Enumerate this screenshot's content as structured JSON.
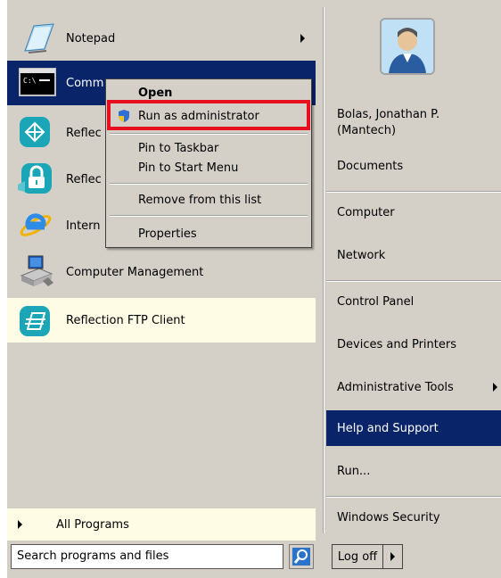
{
  "left": {
    "programs": [
      {
        "label": "Notepad",
        "icon": "notepad-icon",
        "has_submenu": true
      },
      {
        "label": "Comm",
        "icon": "command-prompt-icon",
        "has_submenu": false,
        "selected": true
      },
      {
        "label": "Reflec",
        "icon": "reflection-icon",
        "has_submenu": true
      },
      {
        "label": "Reflec",
        "icon": "reflection-lock-icon",
        "has_submenu": false
      },
      {
        "label": "Intern",
        "icon": "internet-explorer-icon",
        "has_submenu": false
      },
      {
        "label": "Computer Management",
        "icon": "computer-management-icon",
        "has_submenu": false
      },
      {
        "label": "Reflection FTP Client",
        "icon": "reflection-ftp-icon",
        "has_submenu": false,
        "new": true
      }
    ],
    "all_programs": "All Programs",
    "search_placeholder": "Search programs and files"
  },
  "right": {
    "user_name_line1": "Bolas, Jonathan P.",
    "user_name_line2": "(Mantech)",
    "items": [
      {
        "label": "Documents"
      },
      {
        "label": "Computer"
      },
      {
        "label": "Network"
      },
      {
        "label": "Control Panel"
      },
      {
        "label": "Devices and Printers"
      },
      {
        "label": "Administrative Tools",
        "has_submenu": true
      },
      {
        "label": "Help and Support",
        "selected": true
      },
      {
        "label": "Run..."
      },
      {
        "label": "Windows Security"
      }
    ],
    "logoff": "Log off"
  },
  "context_menu": {
    "open": "Open",
    "run_as_admin": "Run as administrator",
    "pin_taskbar": "Pin to Taskbar",
    "pin_start": "Pin to Start Menu",
    "remove": "Remove from this list",
    "properties": "Properties"
  },
  "colors": {
    "selection": "#0a246a",
    "menu_bg": "#d4d0c8",
    "highlight_box": "#e8101e",
    "new_program_bg": "#fffce6"
  }
}
